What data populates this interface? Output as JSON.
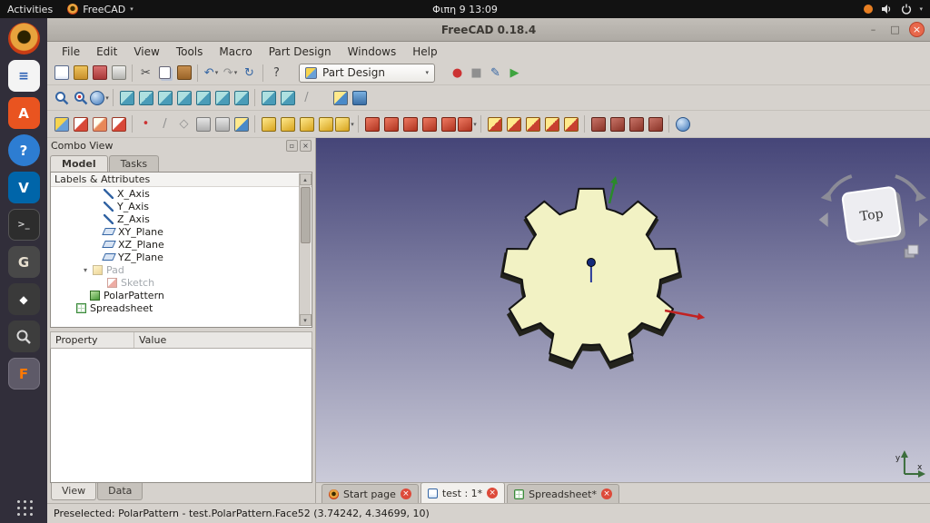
{
  "system_bar": {
    "activities": "Activities",
    "app_name": "FreeCAD",
    "clock": "Φιπη 9  13:09"
  },
  "glyphs": {
    "caret_down": "▾",
    "caret_up": "▴",
    "minimize": "–",
    "maximize": "□",
    "close": "×",
    "float": "▫",
    "scissors": "✂",
    "undo": "↶",
    "redo": "↷",
    "refresh": "↻",
    "question": "?",
    "record": "●",
    "stop": "■",
    "play": "▶",
    "pencil": "✎",
    "point": "•",
    "slash": "/",
    "diamond": "◇",
    "terminal": ">_",
    "software_a": "A",
    "help_q": "?",
    "vscode_v": "V",
    "gimp_g": "G",
    "inkscape_d": "◆",
    "writer_lines": "≡",
    "freecad_f": "F"
  },
  "window": {
    "title": "FreeCAD 0.18.4",
    "menus": [
      "File",
      "Edit",
      "View",
      "Tools",
      "Macro",
      "Part Design",
      "Windows",
      "Help"
    ],
    "workbench": "Part Design"
  },
  "combo_view": {
    "title": "Combo View",
    "tab_model": "Model",
    "tab_tasks": "Tasks",
    "tree_header": "Labels & Attributes",
    "tree": [
      {
        "label": "X_Axis"
      },
      {
        "label": "Y_Axis"
      },
      {
        "label": "Z_Axis"
      },
      {
        "label": "XY_Plane"
      },
      {
        "label": "XZ_Plane"
      },
      {
        "label": "YZ_Plane"
      },
      {
        "label": "Pad"
      },
      {
        "label": "Sketch"
      },
      {
        "label": "PolarPattern"
      },
      {
        "label": "Spreadsheet"
      }
    ],
    "property_col": "Property",
    "value_col": "Value",
    "tab_view": "View",
    "tab_data": "Data"
  },
  "viewport": {
    "navcube": "Top",
    "axis_x": "x",
    "axis_y": "y",
    "doc_tabs": [
      {
        "label": "Start page"
      },
      {
        "label": "test : 1*"
      },
      {
        "label": "Spreadsheet*"
      }
    ]
  },
  "status": {
    "text": "Preselected: PolarPattern - test.PolarPattern.Face52 (3.74242, 4.34699, 10)"
  },
  "colors": {
    "ubuntu_orange": "#e95420",
    "close_button": "#e8684c",
    "viewport_top": "#454578",
    "viewport_bottom": "#cbcbd9",
    "gear_fill": "#f2f2c4",
    "tab_close_red": "#dd4a3a"
  }
}
